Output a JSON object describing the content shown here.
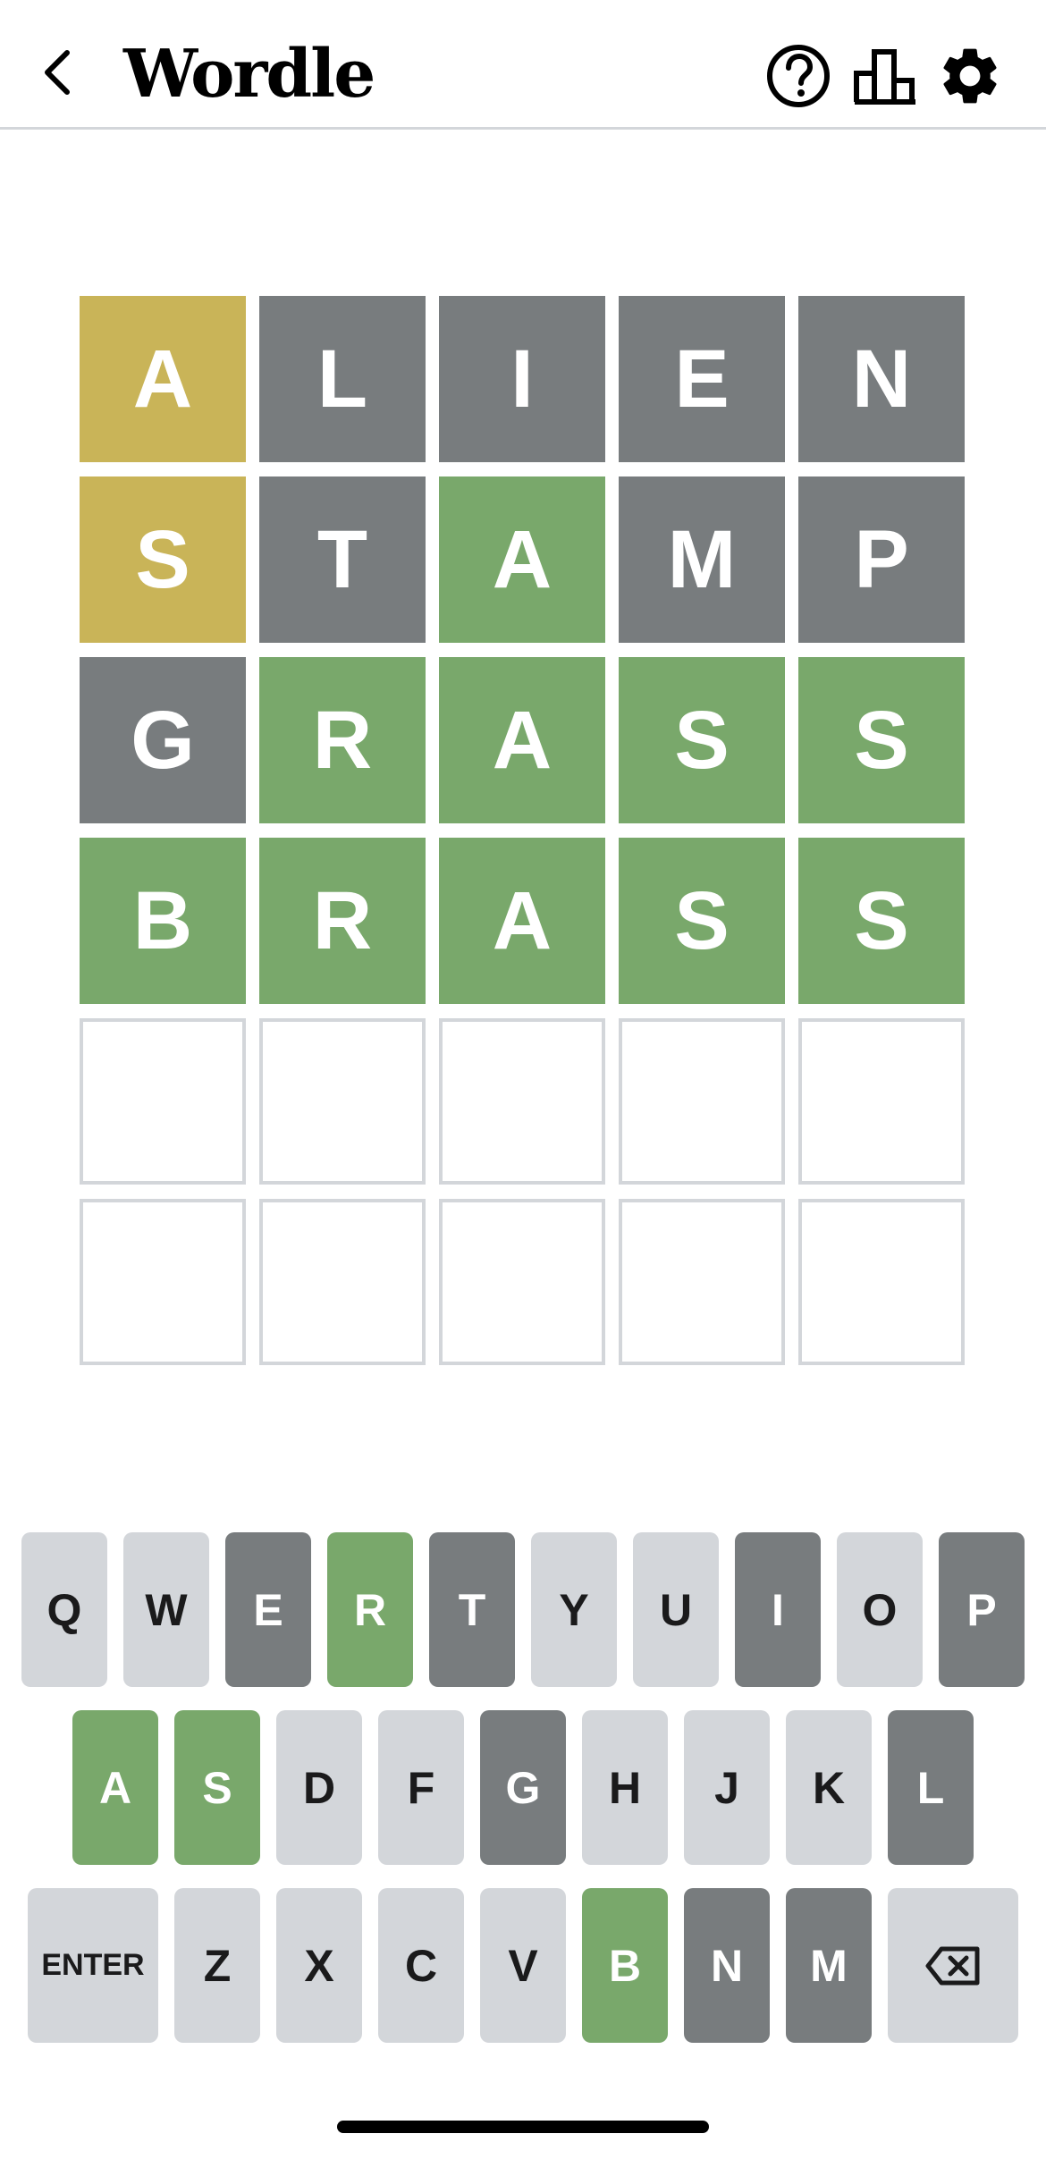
{
  "header": {
    "title": "Wordle"
  },
  "board": {
    "rows": [
      [
        {
          "letter": "A",
          "state": "present"
        },
        {
          "letter": "L",
          "state": "absent"
        },
        {
          "letter": "I",
          "state": "absent"
        },
        {
          "letter": "E",
          "state": "absent"
        },
        {
          "letter": "N",
          "state": "absent"
        }
      ],
      [
        {
          "letter": "S",
          "state": "present"
        },
        {
          "letter": "T",
          "state": "absent"
        },
        {
          "letter": "A",
          "state": "correct"
        },
        {
          "letter": "M",
          "state": "absent"
        },
        {
          "letter": "P",
          "state": "absent"
        }
      ],
      [
        {
          "letter": "G",
          "state": "absent"
        },
        {
          "letter": "R",
          "state": "correct"
        },
        {
          "letter": "A",
          "state": "correct"
        },
        {
          "letter": "S",
          "state": "correct"
        },
        {
          "letter": "S",
          "state": "correct"
        }
      ],
      [
        {
          "letter": "B",
          "state": "correct"
        },
        {
          "letter": "R",
          "state": "correct"
        },
        {
          "letter": "A",
          "state": "correct"
        },
        {
          "letter": "S",
          "state": "correct"
        },
        {
          "letter": "S",
          "state": "correct"
        }
      ],
      [
        {
          "letter": "",
          "state": "empty"
        },
        {
          "letter": "",
          "state": "empty"
        },
        {
          "letter": "",
          "state": "empty"
        },
        {
          "letter": "",
          "state": "empty"
        },
        {
          "letter": "",
          "state": "empty"
        }
      ],
      [
        {
          "letter": "",
          "state": "empty"
        },
        {
          "letter": "",
          "state": "empty"
        },
        {
          "letter": "",
          "state": "empty"
        },
        {
          "letter": "",
          "state": "empty"
        },
        {
          "letter": "",
          "state": "empty"
        }
      ]
    ]
  },
  "keyboard": {
    "rows": [
      [
        {
          "label": "Q",
          "state": "unused"
        },
        {
          "label": "W",
          "state": "unused"
        },
        {
          "label": "E",
          "state": "absent"
        },
        {
          "label": "R",
          "state": "correct"
        },
        {
          "label": "T",
          "state": "absent"
        },
        {
          "label": "Y",
          "state": "unused"
        },
        {
          "label": "U",
          "state": "unused"
        },
        {
          "label": "I",
          "state": "absent"
        },
        {
          "label": "O",
          "state": "unused"
        },
        {
          "label": "P",
          "state": "absent"
        }
      ],
      [
        {
          "label": "A",
          "state": "correct"
        },
        {
          "label": "S",
          "state": "correct"
        },
        {
          "label": "D",
          "state": "unused"
        },
        {
          "label": "F",
          "state": "unused"
        },
        {
          "label": "G",
          "state": "absent"
        },
        {
          "label": "H",
          "state": "unused"
        },
        {
          "label": "J",
          "state": "unused"
        },
        {
          "label": "K",
          "state": "unused"
        },
        {
          "label": "L",
          "state": "absent"
        }
      ],
      [
        {
          "label": "ENTER",
          "state": "unused",
          "wide": true
        },
        {
          "label": "Z",
          "state": "unused"
        },
        {
          "label": "X",
          "state": "unused"
        },
        {
          "label": "C",
          "state": "unused"
        },
        {
          "label": "V",
          "state": "unused"
        },
        {
          "label": "B",
          "state": "correct"
        },
        {
          "label": "N",
          "state": "absent"
        },
        {
          "label": "M",
          "state": "absent"
        },
        {
          "label": "",
          "state": "unused",
          "wide": true,
          "icon": "backspace-icon"
        }
      ]
    ]
  },
  "colors": {
    "correct": "#79a86b",
    "present": "#c9b458",
    "absent": "#787c7e",
    "unused_key": "#d3d6da",
    "empty_border": "#d3d6da"
  },
  "icons": {
    "back": "chevron-left-icon",
    "help": "help-circle-icon",
    "stats": "bar-chart-icon",
    "settings": "gear-icon",
    "backspace": "backspace-icon"
  }
}
